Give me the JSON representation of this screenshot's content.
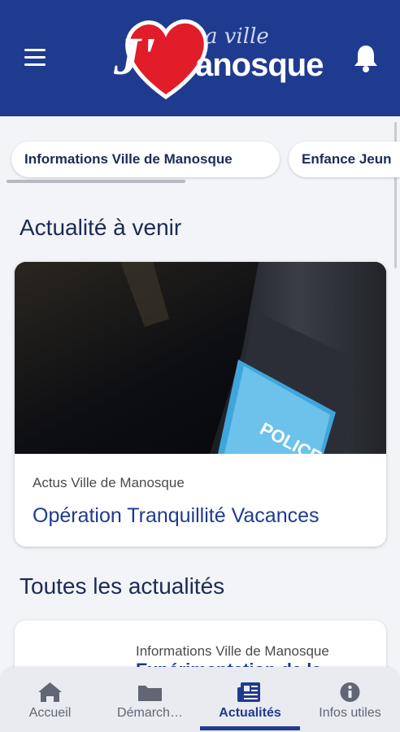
{
  "header": {
    "logo_j": "J'",
    "logo_ville": "a ville",
    "logo_name": "anosque",
    "menu_icon": "hamburger-menu-icon",
    "bell_icon": "bell-icon"
  },
  "chips": [
    {
      "label": "Informations Ville de Manosque"
    },
    {
      "label": "Enfance Jeun"
    }
  ],
  "sections": {
    "upcoming_title": "Actualité à venir",
    "all_title": "Toutes les actualités"
  },
  "featured": {
    "source": "Actus Ville de Manosque",
    "title": "Opération Tranquillité Vacances",
    "patch_text": "POLICE"
  },
  "news_item": {
    "source": "Informations Ville de Manosque",
    "title": "Expérimentation de la"
  },
  "nav": {
    "items": [
      {
        "label": "Accueil",
        "icon": "home-icon"
      },
      {
        "label": "Démarch…",
        "icon": "folder-icon"
      },
      {
        "label": "Actualités",
        "icon": "newspaper-icon"
      },
      {
        "label": "Infos utiles",
        "icon": "info-icon"
      }
    ],
    "active_index": 2
  },
  "colors": {
    "brand_blue": "#1f3b8f",
    "heart_red": "#e11d2a",
    "background": "#f3f4f7"
  }
}
